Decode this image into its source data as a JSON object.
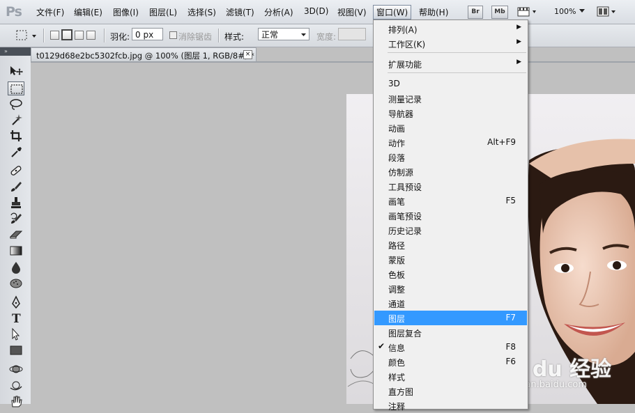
{
  "app": {
    "logo": "Ps"
  },
  "menubar": {
    "items": [
      "文件(F)",
      "编辑(E)",
      "图像(I)",
      "图层(L)",
      "选择(S)",
      "滤镜(T)",
      "分析(A)",
      "3D(D)",
      "视图(V)",
      "窗口(W)",
      "帮助(H)"
    ],
    "active_item": "窗口(W)",
    "bridge_label": "Br",
    "minibridge_label": "Mb",
    "zoom": "100%"
  },
  "options": {
    "feather_label": "羽化:",
    "feather_value": "0 px",
    "antialias_label": "消除锯齿",
    "style_label": "样式:",
    "style_value": "正常",
    "width_label": "宽度:"
  },
  "toolbar": {
    "collapse_glyph": "»"
  },
  "document": {
    "tab_title": "t0129d68e2bc5302fcb.jpg @ 100% (图层 1, RGB/8#) *",
    "close_glyph": "×"
  },
  "watermark": {
    "brand": "Bai du 经验",
    "url": "jingyan.baidu.com"
  },
  "window_menu": {
    "items": [
      {
        "label": "排列(A)",
        "shortcut": "",
        "submenu": true
      },
      {
        "label": "工作区(K)",
        "shortcut": "",
        "submenu": true
      },
      {
        "label": "扩展功能",
        "shortcut": "",
        "submenu": true
      },
      {
        "label": "3D",
        "shortcut": ""
      },
      {
        "label": "测量记录",
        "shortcut": ""
      },
      {
        "label": "导航器",
        "shortcut": ""
      },
      {
        "label": "动画",
        "shortcut": ""
      },
      {
        "label": "动作",
        "shortcut": "Alt+F9"
      },
      {
        "label": "段落",
        "shortcut": ""
      },
      {
        "label": "仿制源",
        "shortcut": ""
      },
      {
        "label": "工具预设",
        "shortcut": ""
      },
      {
        "label": "画笔",
        "shortcut": "F5"
      },
      {
        "label": "画笔预设",
        "shortcut": ""
      },
      {
        "label": "历史记录",
        "shortcut": ""
      },
      {
        "label": "路径",
        "shortcut": ""
      },
      {
        "label": "蒙版",
        "shortcut": ""
      },
      {
        "label": "色板",
        "shortcut": ""
      },
      {
        "label": "调整",
        "shortcut": ""
      },
      {
        "label": "通道",
        "shortcut": ""
      },
      {
        "label": "图层",
        "shortcut": "F7",
        "highlighted": true
      },
      {
        "label": "图层复合",
        "shortcut": ""
      },
      {
        "label": "信息",
        "shortcut": "F8",
        "checked": true
      },
      {
        "label": "颜色",
        "shortcut": "F6"
      },
      {
        "label": "样式",
        "shortcut": ""
      },
      {
        "label": "直方图",
        "shortcut": ""
      },
      {
        "label": "注释",
        "shortcut": ""
      }
    ],
    "check_glyph": "✔",
    "submenu_glyph": "▶"
  },
  "colors": {
    "highlight": "#3399ff",
    "canvas_bg": "#c0c0c0"
  }
}
